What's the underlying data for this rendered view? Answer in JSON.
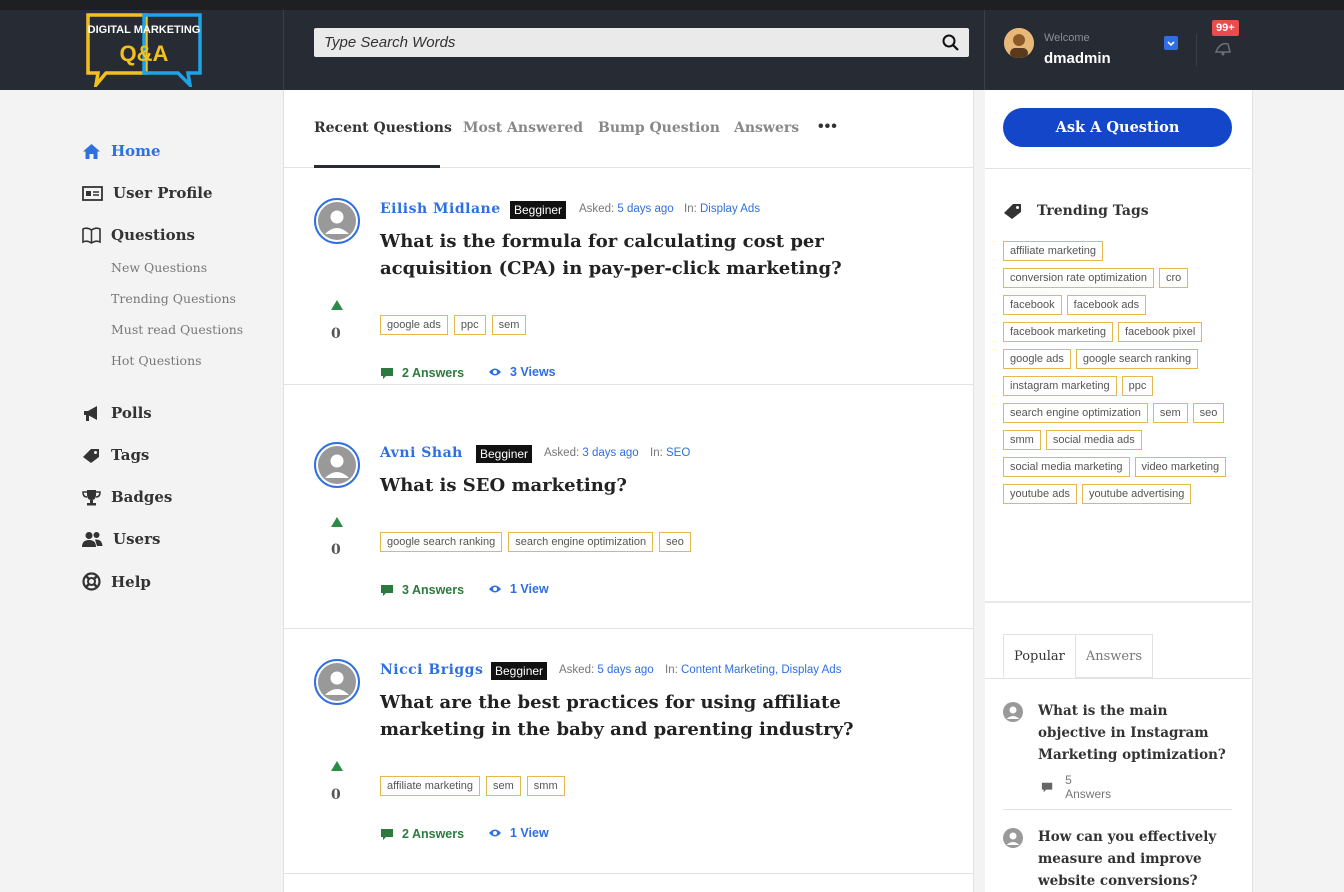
{
  "header": {
    "logo_line1": "DIGITAL MARKETING",
    "logo_line2": "Q&A",
    "search_placeholder": "Type Search Words",
    "welcome": "Welcome",
    "username": "dmadmin",
    "notif_count": "99+"
  },
  "sidebar": {
    "items": [
      {
        "label": "Home",
        "icon": "home-icon"
      },
      {
        "label": "User Profile",
        "icon": "id-card-icon"
      },
      {
        "label": "Questions",
        "icon": "book-icon"
      },
      {
        "label": "Polls",
        "icon": "megaphone-icon"
      },
      {
        "label": "Tags",
        "icon": "tag-icon"
      },
      {
        "label": "Badges",
        "icon": "trophy-icon"
      },
      {
        "label": "Users",
        "icon": "users-icon"
      },
      {
        "label": "Help",
        "icon": "lifebuoy-icon"
      }
    ],
    "subitems": [
      "New Questions",
      "Trending Questions",
      "Must read Questions",
      "Hot Questions"
    ]
  },
  "tabs": [
    "Recent Questions",
    "Most Answered",
    "Bump Question",
    "Answers"
  ],
  "questions": [
    {
      "author": "Eilish Midlane",
      "badge": "Begginer",
      "asked_label": "Asked:",
      "asked": "5 days ago",
      "in_label": "In:",
      "category": "Display Ads",
      "title": "What is the formula for calculating cost per acquisition (CPA) in pay-per-click marketing?",
      "votes": "0",
      "tags": [
        "google ads",
        "ppc",
        "sem"
      ],
      "answers": "2 Answers",
      "views": "3 Views"
    },
    {
      "author": "Avni Shah",
      "badge": "Begginer",
      "asked_label": "Asked:",
      "asked": "3 days ago",
      "in_label": "In:",
      "category": "SEO",
      "title": "What is SEO marketing?",
      "votes": "0",
      "tags": [
        "google search ranking",
        "search engine optimization",
        "seo"
      ],
      "answers": "3 Answers",
      "views": "1 View"
    },
    {
      "author": "Nicci Briggs",
      "badge": "Begginer",
      "asked_label": "Asked:",
      "asked": "5 days ago",
      "in_label": "In:",
      "category": "Content Marketing, Display Ads",
      "title": "What are the best practices for using affiliate marketing in the baby and parenting industry?",
      "votes": "0",
      "tags": [
        "affiliate marketing",
        "sem",
        "smm"
      ],
      "answers": "2 Answers",
      "views": "1 View"
    }
  ],
  "right": {
    "ask_button": "Ask A Question",
    "trending_title": "Trending Tags",
    "trending_tags": [
      "affiliate marketing",
      "conversion rate optimization",
      "cro",
      "facebook",
      "facebook ads",
      "facebook marketing",
      "facebook pixel",
      "google ads",
      "google search ranking",
      "instagram marketing",
      "ppc",
      "search engine optimization",
      "sem",
      "seo",
      "smm",
      "social media ads",
      "social media marketing",
      "video marketing",
      "youtube ads",
      "youtube advertising"
    ],
    "tabs": [
      "Popular",
      "Answers"
    ],
    "popular": [
      {
        "title": "What is the main objective in Instagram Marketing optimization?",
        "answers": "5 Answers"
      },
      {
        "title": "How can you effectively measure and improve website conversions?"
      }
    ]
  }
}
